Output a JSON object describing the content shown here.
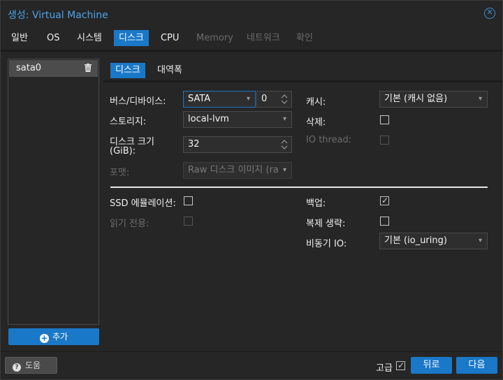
{
  "title": {
    "prefix": "생성:",
    "name": "Virtual Machine"
  },
  "tabs": [
    {
      "label": "일반",
      "state": "normal"
    },
    {
      "label": "OS",
      "state": "normal"
    },
    {
      "label": "시스템",
      "state": "normal"
    },
    {
      "label": "디스크",
      "state": "active"
    },
    {
      "label": "CPU",
      "state": "normal"
    },
    {
      "label": "Memory",
      "state": "disabled"
    },
    {
      "label": "네트워크",
      "state": "disabled"
    },
    {
      "label": "확인",
      "state": "disabled"
    }
  ],
  "disk_list": {
    "items": [
      {
        "label": "sata0"
      }
    ],
    "add_label": "추가"
  },
  "subtabs": [
    {
      "label": "디스크",
      "state": "active"
    },
    {
      "label": "대역폭",
      "state": "normal"
    }
  ],
  "form": {
    "bus_label": "버스/디바이스:",
    "bus_value": "SATA",
    "device_value": "0",
    "storage_label": "스토리지:",
    "storage_value": "local-lvm",
    "size_label_line1": "디스크 크기",
    "size_label_line2": "(GiB):",
    "size_value": "32",
    "format_label": "포맷:",
    "format_value": "Raw 디스크 이미지 (ra",
    "cache_label": "캐시:",
    "cache_value": "기본 (캐시 없음)",
    "discard_label": "삭제:",
    "discard_checked": false,
    "iothread_label": "IO thread:",
    "iothread_checked": false,
    "ssd_label": "SSD 에뮬레이션:",
    "ssd_checked": false,
    "readonly_label": "읽기 전용:",
    "readonly_checked": false,
    "backup_label": "백업:",
    "backup_checked": true,
    "replicate_label": "복제 생략:",
    "replicate_checked": false,
    "async_label": "비동기 IO:",
    "async_value": "기본 (io_uring)"
  },
  "footer": {
    "help_label": "도움",
    "advanced_label": "고급",
    "advanced_checked": true,
    "back_label": "뒤로",
    "next_label": "다음"
  },
  "colors": {
    "accent": "#1a78c8",
    "title": "#4aa3ea",
    "background": "#262626"
  }
}
